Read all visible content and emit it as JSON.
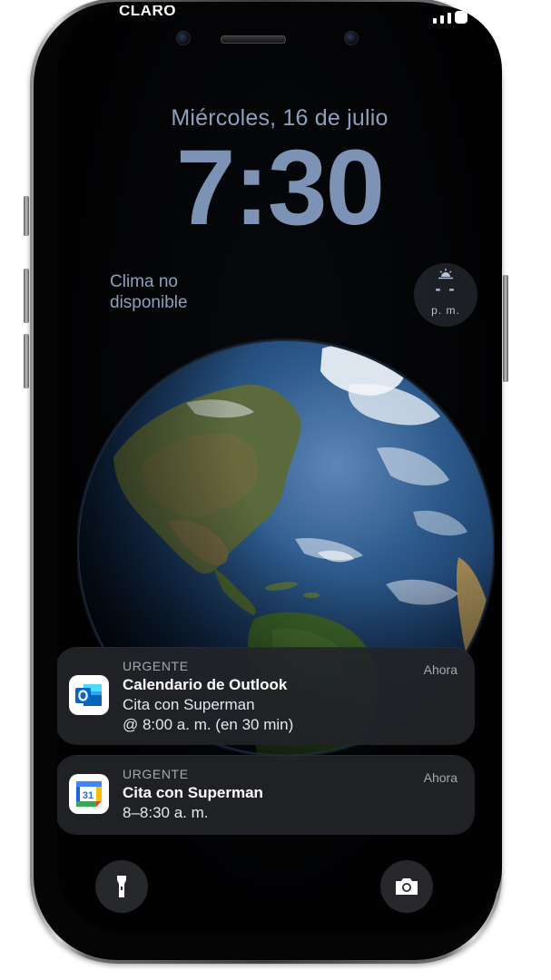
{
  "status_bar": {
    "carrier": "CLARO"
  },
  "lock_screen": {
    "date": "Miércoles, 16 de julio",
    "time": "7:30",
    "weather_widget": {
      "line1": "Clima no",
      "line2": "disponible"
    },
    "sunset_widget": {
      "value": "- -",
      "period": "p. m.",
      "icon": "sunset-icon"
    }
  },
  "notifications": [
    {
      "app_icon": "outlook-icon",
      "category": "URGENTE",
      "time": "Ahora",
      "title": "Calendario de Outlook",
      "lines": [
        "Cita con Superman",
        "@ 8:00 a. m. (en 30 min)"
      ]
    },
    {
      "app_icon": "google-calendar-icon",
      "icon_text": "31",
      "category": "URGENTE",
      "time": "Ahora",
      "title": "Cita con Superman",
      "lines": [
        "8–8:30 a. m."
      ]
    }
  ],
  "quick_actions": [
    {
      "icon": "flashlight-icon"
    },
    {
      "icon": "camera-icon"
    }
  ],
  "colors": {
    "clock": "#7d93b5",
    "notification_bg": "#222428",
    "outlook_blue": "#0a64c8",
    "gcal_blue": "#4285f4"
  }
}
